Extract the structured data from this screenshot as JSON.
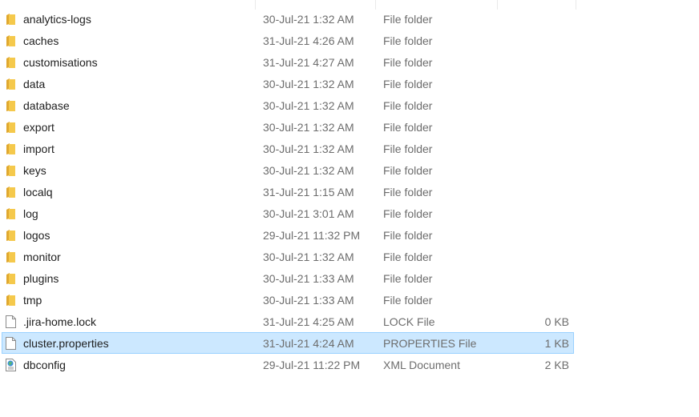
{
  "colors": {
    "selection_bg": "#cce8ff",
    "selection_border": "#99d1ff",
    "folder": "#f5c94c"
  },
  "files": [
    {
      "name": "analytics-logs",
      "date": "30-Jul-21 1:32 AM",
      "type": "File folder",
      "size": "",
      "icon": "folder-icon"
    },
    {
      "name": "caches",
      "date": "31-Jul-21 4:26 AM",
      "type": "File folder",
      "size": "",
      "icon": "folder-icon"
    },
    {
      "name": "customisations",
      "date": "31-Jul-21 4:27 AM",
      "type": "File folder",
      "size": "",
      "icon": "folder-icon"
    },
    {
      "name": "data",
      "date": "30-Jul-21 1:32 AM",
      "type": "File folder",
      "size": "",
      "icon": "folder-icon"
    },
    {
      "name": "database",
      "date": "30-Jul-21 1:32 AM",
      "type": "File folder",
      "size": "",
      "icon": "folder-icon"
    },
    {
      "name": "export",
      "date": "30-Jul-21 1:32 AM",
      "type": "File folder",
      "size": "",
      "icon": "folder-icon"
    },
    {
      "name": "import",
      "date": "30-Jul-21 1:32 AM",
      "type": "File folder",
      "size": "",
      "icon": "folder-icon"
    },
    {
      "name": "keys",
      "date": "30-Jul-21 1:32 AM",
      "type": "File folder",
      "size": "",
      "icon": "folder-icon"
    },
    {
      "name": "localq",
      "date": "31-Jul-21 1:15 AM",
      "type": "File folder",
      "size": "",
      "icon": "folder-icon"
    },
    {
      "name": "log",
      "date": "30-Jul-21 3:01 AM",
      "type": "File folder",
      "size": "",
      "icon": "folder-icon"
    },
    {
      "name": "logos",
      "date": "29-Jul-21 11:32 PM",
      "type": "File folder",
      "size": "",
      "icon": "folder-icon"
    },
    {
      "name": "monitor",
      "date": "30-Jul-21 1:32 AM",
      "type": "File folder",
      "size": "",
      "icon": "folder-icon"
    },
    {
      "name": "plugins",
      "date": "30-Jul-21 1:33 AM",
      "type": "File folder",
      "size": "",
      "icon": "folder-icon"
    },
    {
      "name": "tmp",
      "date": "30-Jul-21 1:33 AM",
      "type": "File folder",
      "size": "",
      "icon": "folder-icon"
    },
    {
      "name": ".jira-home.lock",
      "date": "31-Jul-21 4:25 AM",
      "type": "LOCK File",
      "size": "0 KB",
      "icon": "file-icon"
    },
    {
      "name": "cluster.properties",
      "date": "31-Jul-21 4:24 AM",
      "type": "PROPERTIES File",
      "size": "1 KB",
      "icon": "file-icon",
      "selected": true
    },
    {
      "name": "dbconfig",
      "date": "29-Jul-21 11:22 PM",
      "type": "XML Document",
      "size": "2 KB",
      "icon": "xml-document-icon"
    }
  ]
}
